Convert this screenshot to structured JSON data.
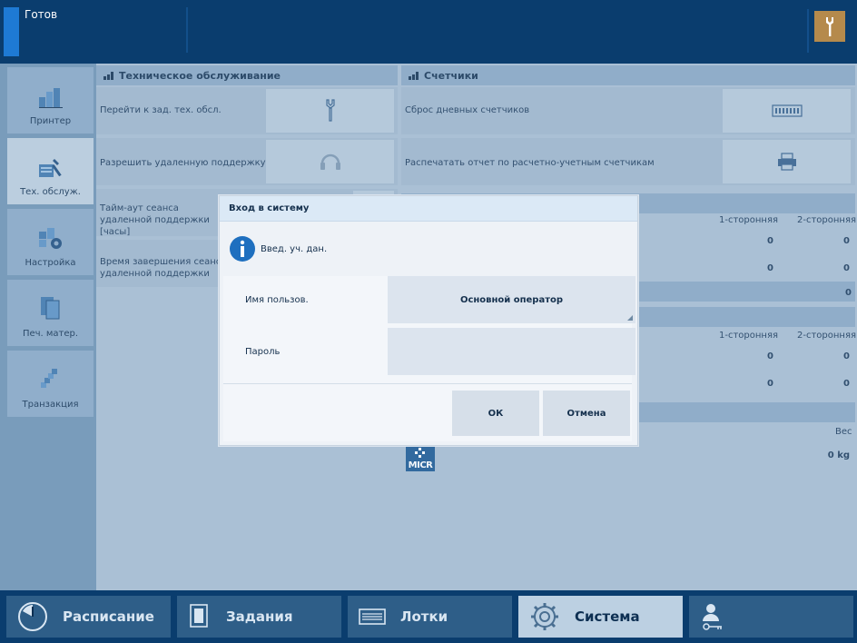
{
  "header": {
    "status": "Готов"
  },
  "sidebar": {
    "items": [
      {
        "label": "Принтер",
        "icon": "printer-icon"
      },
      {
        "label": "Тех. обслуж.",
        "icon": "maintenance-icon",
        "active": true
      },
      {
        "label": "Настройка",
        "icon": "setup-icon"
      },
      {
        "label": "Печ. матер.",
        "icon": "media-icon"
      },
      {
        "label": "Транзакция",
        "icon": "transaction-icon"
      }
    ]
  },
  "maintenance": {
    "title": "Техническое обслуживание",
    "rows": [
      {
        "label": "Перейти к зад. тех. обсл."
      },
      {
        "label": "Разрешить удаленную поддержку"
      },
      {
        "label": "Тайм-аут сеанса удаленной поддержки [часы]"
      },
      {
        "label": "Время завершения сеанса удаленной поддержки"
      }
    ]
  },
  "counters": {
    "title": "Счетчики",
    "rows": [
      {
        "label": "Сброс дневных счетчиков"
      },
      {
        "label": "Распечатать отчет по расчетно-учетным счетчикам"
      }
    ],
    "table1": {
      "col1": "1-сторонняя",
      "col2": "2-сторонняя",
      "r1": [
        "0",
        "0"
      ],
      "r2": [
        "0",
        "0"
      ],
      "total": "0"
    },
    "table2": {
      "col1": "1-сторонняя",
      "col2": "2-сторонняя",
      "r1": [
        "0",
        "0"
      ],
      "r2": [
        "0",
        "0"
      ]
    },
    "table3": {
      "col": "Вес",
      "value": "0 kg"
    },
    "badge": "MICR"
  },
  "dialog": {
    "title": "Вход в систему",
    "message": "Введ. уч. дан.",
    "username_label": "Имя пользов.",
    "username_value": "Основной оператор",
    "password_label": "Пароль",
    "password_value": "",
    "ok": "ОК",
    "cancel": "Отмена"
  },
  "nav": {
    "tabs": [
      {
        "label": "Расписание",
        "icon": "clock-icon"
      },
      {
        "label": "Задания",
        "icon": "jobs-icon"
      },
      {
        "label": "Лотки",
        "icon": "trays-icon"
      },
      {
        "label": "Система",
        "icon": "gear-icon",
        "active": true
      },
      {
        "label": "",
        "icon": "user-key-icon"
      }
    ]
  },
  "colors": {
    "header_bg": "#0a3d6e",
    "accent_blue": "#1e7ad4",
    "maintenance_button": "#b58a4c",
    "active_nav": "#bcd0e2"
  }
}
